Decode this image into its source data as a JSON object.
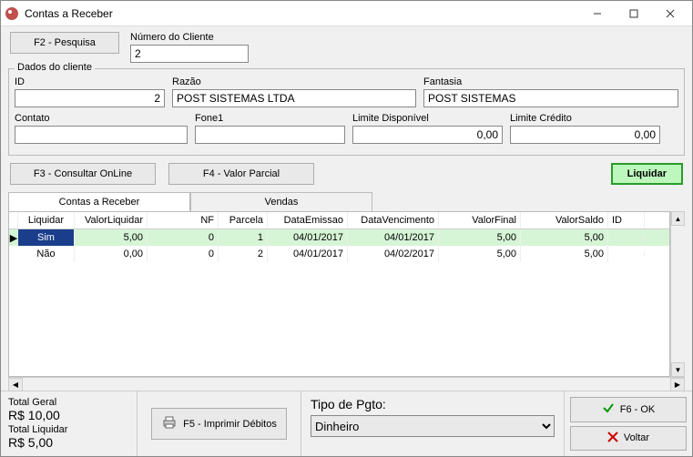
{
  "window": {
    "title": "Contas a Receber"
  },
  "top": {
    "search_btn": "F2 - Pesquisa",
    "num_cliente_label": "Número do Cliente",
    "num_cliente": "2"
  },
  "cliente": {
    "group_title": "Dados do cliente",
    "id_label": "ID",
    "id": "2",
    "razao_label": "Razão",
    "razao": "POST SISTEMAS LTDA",
    "fantasia_label": "Fantasia",
    "fantasia": "POST SISTEMAS",
    "contato_label": "Contato",
    "contato": "",
    "fone_label": "Fone1",
    "fone": "",
    "limdisp_label": "Limite Disponível",
    "limdisp": "0,00",
    "limcred_label": "Limite Crédito",
    "limcred": "0,00"
  },
  "mid": {
    "f3": "F3 - Consultar OnLine",
    "f4": "F4 - Valor Parcial",
    "liquidar": "Liquidar"
  },
  "tabs": {
    "t1": "Contas a Receber",
    "t2": "Vendas"
  },
  "grid": {
    "headers": {
      "liq": "Liquidar",
      "vl": "ValorLiquidar",
      "nf": "NF",
      "par": "Parcela",
      "de": "DataEmissao",
      "dv": "DataVencimento",
      "vf": "ValorFinal",
      "vs": "ValorSaldo",
      "id": "ID"
    },
    "rows": [
      {
        "liq": "Sim",
        "vl": "5,00",
        "nf": "0",
        "par": "1",
        "de": "04/01/2017",
        "dv": "04/01/2017",
        "vf": "5,00",
        "vs": "5,00",
        "id": ""
      },
      {
        "liq": "Não",
        "vl": "0,00",
        "nf": "0",
        "par": "2",
        "de": "04/01/2017",
        "dv": "04/02/2017",
        "vf": "5,00",
        "vs": "5,00",
        "id": ""
      }
    ]
  },
  "footer": {
    "tg_label": "Total Geral",
    "tg": "R$ 10,00",
    "tl_label": "Total Liquidar",
    "tl": "R$ 5,00",
    "print": "F5 - Imprimir Débitos",
    "pagto_label": "Tipo de Pgto:",
    "pagto_value": "Dinheiro",
    "ok": "F6 - OK",
    "voltar": "Voltar"
  }
}
